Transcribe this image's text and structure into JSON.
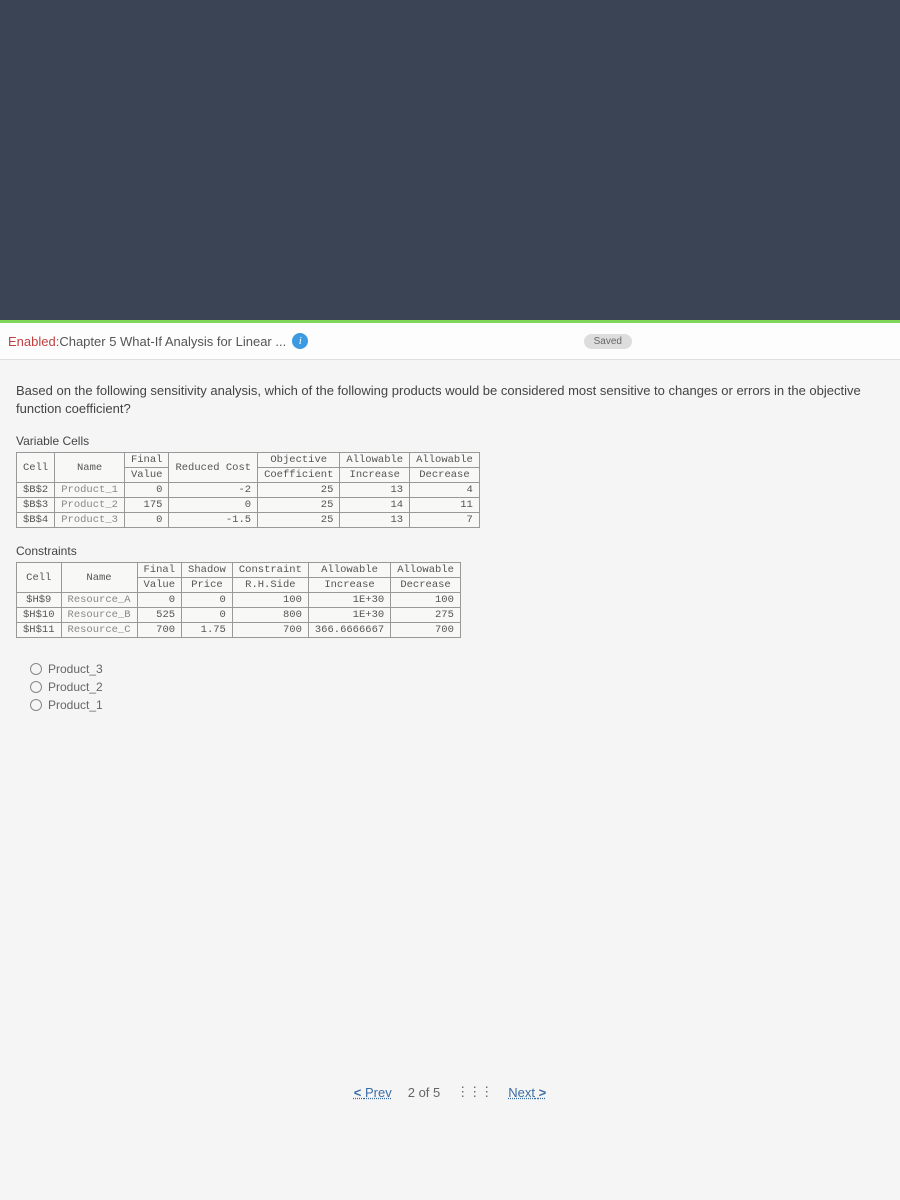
{
  "header": {
    "title_prefix": "Enabled:",
    "title_rest": " Chapter 5 What-If Analysis for Linear ... ",
    "saved": "Saved"
  },
  "question": "Based on the following sensitivity analysis, which of the following products would be considered most sensitive to changes or errors in the objective function coefficient?",
  "variable_cells": {
    "label": "Variable Cells",
    "headers": {
      "cell": "Cell",
      "name": "Name",
      "final": "Final",
      "value": "Value",
      "reduced": "Reduced Cost",
      "obj": "Objective",
      "coef": "Coefficient",
      "allow": "Allowable",
      "inc": "Increase",
      "dec": "Decrease"
    },
    "rows": [
      {
        "cell": "$B$2",
        "name": "Product_1",
        "final": "0",
        "reduced": "-2",
        "obj": "25",
        "inc": "13",
        "dec": "4"
      },
      {
        "cell": "$B$3",
        "name": "Product_2",
        "final": "175",
        "reduced": "0",
        "obj": "25",
        "inc": "14",
        "dec": "11"
      },
      {
        "cell": "$B$4",
        "name": "Product_3",
        "final": "0",
        "reduced": "-1.5",
        "obj": "25",
        "inc": "13",
        "dec": "7"
      }
    ]
  },
  "constraints": {
    "label": "Constraints",
    "headers": {
      "cell": "Cell",
      "name": "Name",
      "final": "Final",
      "value": "Value",
      "shadow": "Shadow",
      "price": "Price",
      "cons": "Constraint",
      "rhs": "R.H.Side",
      "allow": "Allowable",
      "inc": "Increase",
      "dec": "Decrease"
    },
    "rows": [
      {
        "cell": "$H$9",
        "name": "Resource_A",
        "final": "0",
        "shadow": "0",
        "cons": "100",
        "inc": "1E+30",
        "dec": "100"
      },
      {
        "cell": "$H$10",
        "name": "Resource_B",
        "final": "525",
        "shadow": "0",
        "cons": "800",
        "inc": "1E+30",
        "dec": "275"
      },
      {
        "cell": "$H$11",
        "name": "Resource_C",
        "final": "700",
        "shadow": "1.75",
        "cons": "700",
        "inc": "366.6666667",
        "dec": "700"
      }
    ]
  },
  "answers": [
    "Product_3",
    "Product_2",
    "Product_1"
  ],
  "nav": {
    "prev": "Prev",
    "next": "Next",
    "page": "2",
    "of": "of",
    "total": "5"
  },
  "icons": {
    "info": "i",
    "grid": "⋮⋮⋮",
    "left": "<",
    "right": ">"
  }
}
